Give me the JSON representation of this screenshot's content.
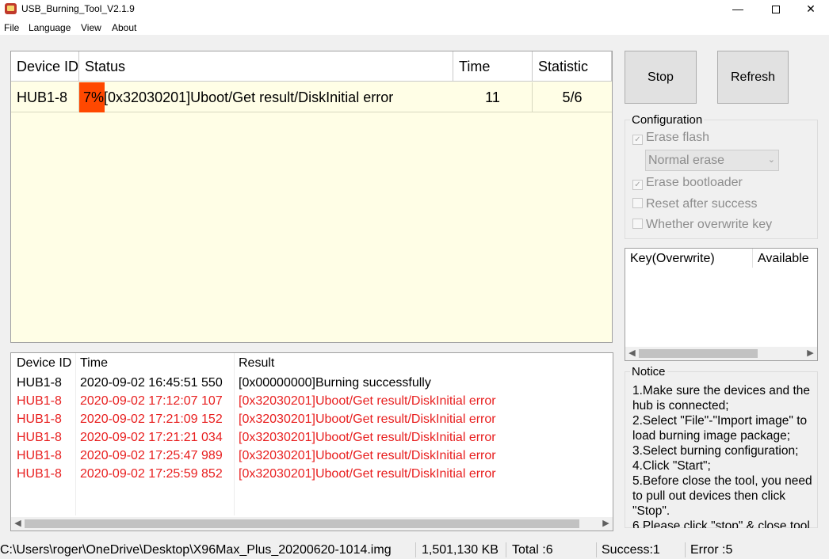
{
  "window": {
    "title": "USB_Burning_Tool_V2.1.9",
    "minimize_glyph": "—",
    "close_glyph": "✕"
  },
  "menu": [
    "File",
    "Language",
    "View",
    "About"
  ],
  "device_table": {
    "headers": [
      "Device ID",
      "Status",
      "Time",
      "Statistic"
    ],
    "rows": [
      {
        "device_id": "HUB1-8",
        "progress": "7%",
        "progress_fraction": 0.07,
        "status": "[0x32030201]Uboot/Get result/DiskInitial error",
        "time": "11",
        "statistic": "5/6"
      }
    ],
    "progress_color": "#ff4800"
  },
  "log": {
    "headers": [
      "Device ID",
      "Time",
      "Result"
    ],
    "rows": [
      {
        "device_id": "HUB1-8",
        "time": "2020-09-02 16:45:51 550",
        "result": "[0x00000000]Burning successfully",
        "error": false
      },
      {
        "device_id": "HUB1-8",
        "time": "2020-09-02 17:12:07 107",
        "result": "[0x32030201]Uboot/Get result/DiskInitial error",
        "error": true
      },
      {
        "device_id": "HUB1-8",
        "time": "2020-09-02 17:21:09 152",
        "result": "[0x32030201]Uboot/Get result/DiskInitial error",
        "error": true
      },
      {
        "device_id": "HUB1-8",
        "time": "2020-09-02 17:21:21 034",
        "result": "[0x32030201]Uboot/Get result/DiskInitial error",
        "error": true
      },
      {
        "device_id": "HUB1-8",
        "time": "2020-09-02 17:25:47 989",
        "result": "[0x32030201]Uboot/Get result/DiskInitial error",
        "error": true
      },
      {
        "device_id": "HUB1-8",
        "time": "2020-09-02 17:25:59 852",
        "result": "[0x32030201]Uboot/Get result/DiskInitial error",
        "error": true
      }
    ],
    "error_color": "#e81f1f"
  },
  "buttons": {
    "stop": "Stop",
    "refresh": "Refresh"
  },
  "configuration": {
    "title": "Configuration",
    "erase_flash": {
      "label": "Erase flash",
      "checked": true
    },
    "erase_mode": "Normal erase",
    "erase_bootloader": {
      "label": "Erase bootloader",
      "checked": true
    },
    "reset_after_success": {
      "label": "Reset after success",
      "checked": false
    },
    "overwrite_key": {
      "label": "Whether overwrite key",
      "checked": false
    }
  },
  "key_list": {
    "headers": [
      "Key(Overwrite)",
      "Available"
    ]
  },
  "notice": {
    "title": "Notice",
    "lines": [
      "1.Make sure the devices and the hub is connected;",
      "2.Select \"File\"-\"Import image\" to load burning image package;",
      "3.Select burning configuration;",
      "4.Click \"Start\";",
      "5.Before close the tool, you need to pull out devices then click \"Stop\".",
      "6.Please click \"stop\" & close tool"
    ]
  },
  "statusbar": {
    "path": "C:\\Users\\roger\\OneDrive\\Desktop\\X96Max_Plus_20200620-1014.img",
    "size": "1,501,130 KB",
    "total": "Total :6",
    "success": "Success:1",
    "error": "Error :5"
  }
}
